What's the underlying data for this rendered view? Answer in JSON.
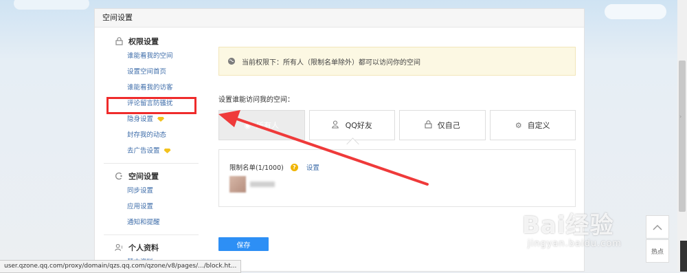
{
  "panel": {
    "title": "空间设置"
  },
  "sidebar": {
    "groups": [
      {
        "title": "权限设置",
        "icon": "lock-icon",
        "items": [
          "谁能看我的空间",
          "设置空间首页",
          "谁能看我的访客",
          "评论留言防骚扰",
          "隐身设置",
          "封存我的动态",
          "去广告设置"
        ]
      },
      {
        "title": "空间设置",
        "icon": "space-icon",
        "items": [
          "同步设置",
          "应用设置",
          "通知和提醒"
        ]
      },
      {
        "title": "个人资料",
        "icon": "user-icon",
        "items": [
          "基本资料"
        ]
      }
    ]
  },
  "main": {
    "notice": "当前权限下：所有人（限制名单除外）都可以访问你的空间",
    "section_label": "设置谁能访问我的空间：",
    "options": [
      {
        "label": "所有人",
        "icon": "globe-icon",
        "active": true
      },
      {
        "label": "QQ好友",
        "icon": "friends-icon",
        "active": false
      },
      {
        "label": "仅自己",
        "icon": "lock-icon",
        "active": false
      },
      {
        "label": "自定义",
        "icon": "gear-icon",
        "active": false
      }
    ],
    "restrict_label": "限制名单(1/1000)",
    "help_icon": "?",
    "settings_link": "设置",
    "save_label": "保存"
  },
  "statusbar": {
    "url": "user.qzone.qq.com/proxy/domain/qzs.qq.com/qzone/v8/pages/.../block.ht..."
  },
  "watermark": {
    "brand": "Bai经验",
    "sub": "jingyan.baidu.com"
  },
  "hot_label": "热点",
  "colors": {
    "highlight": "#ef2b2b",
    "link": "#3d6ca9",
    "save": "#2d8ff5",
    "notice_bg": "#fcf8e3"
  }
}
